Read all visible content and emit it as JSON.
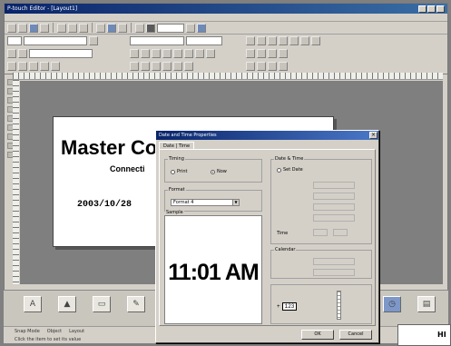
{
  "app": {
    "title": "P-touch Editor - [Layout1]"
  },
  "label": {
    "title": "Master Co",
    "subtitle": "Connecti",
    "date": "2003/10/28"
  },
  "dialog": {
    "title": "Date and Time Properties",
    "tab": "Date | Time",
    "group_timing": "Timing",
    "radio_print": "Print",
    "radio_now": "Now",
    "group_format": "Format",
    "format_value": "Format 4",
    "group_sample": "Sample",
    "sample_time": "11:01 AM",
    "group_date_time": "Date & Time",
    "radio_set_date": "Set Date",
    "label_time": "Time",
    "group_calendar": "Calendar",
    "stepper_value": "123",
    "ok_label": "OK",
    "cancel_label": "Cancel"
  },
  "statusbar": {
    "tab1": "Snap Mode",
    "tab2": "Object",
    "tab3": "Layout",
    "line": "Click the item to set its value"
  },
  "corner": {
    "text": "HI"
  },
  "colors": {
    "titlebar": "#0a246a",
    "chrome": "#d4d0c8",
    "canvas": "#7f7f7f"
  }
}
